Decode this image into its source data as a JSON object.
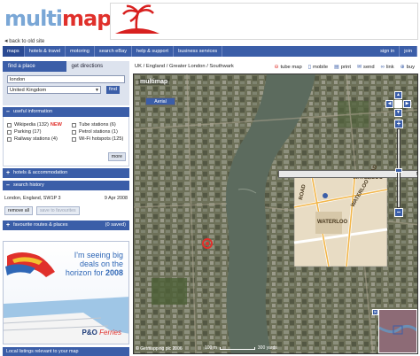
{
  "header": {
    "logo_part1": "multi",
    "logo_part2": "map",
    "back_link": "back to old site"
  },
  "nav": {
    "items": [
      "maps",
      "hotels & travel",
      "motoring",
      "search eBay",
      "help & support",
      "business services"
    ],
    "right_items": [
      "sign in",
      "join"
    ]
  },
  "panel": {
    "tab_find": "find a place",
    "tab_directions": "get directions",
    "search_value": "london",
    "country_value": "United Kingdom",
    "find_button": "find",
    "useful_header": "useful information",
    "useful_items": [
      {
        "label": "Wikipedia (132)",
        "badge": "NEW"
      },
      {
        "label": "Tube stations (6)",
        "badge": ""
      },
      {
        "label": "Parking (17)",
        "badge": ""
      },
      {
        "label": "Petrol stations (1)",
        "badge": ""
      },
      {
        "label": "Railway stations (4)",
        "badge": ""
      },
      {
        "label": "Wi-Fi hotspots (125)",
        "badge": ""
      }
    ],
    "more_button": "more",
    "hotels_header": "hotels & accommodation",
    "history_header": "search history",
    "history_place": "London, England, SW1P 3",
    "history_date": "9 Apr 2008",
    "remove_all": "remove all",
    "save_favourites": "save to favourites",
    "favourites_header": "favourite routes & places",
    "favourites_count": "(0 saved)",
    "bottom_link": "Local listings relevant to your map"
  },
  "ad_left": {
    "line1": "I'm seeing big",
    "line2": "deals on the",
    "line3": "horizon for",
    "year": "2008",
    "brand": "P&O",
    "brand2": "Ferries"
  },
  "map": {
    "breadcrumb": "UK / England / Greater London / Southwark",
    "tools": [
      {
        "icon": "tube-icon",
        "label": "tube map"
      },
      {
        "icon": "mobile-icon",
        "label": "mobile"
      },
      {
        "icon": "print-icon",
        "label": "print"
      },
      {
        "icon": "send-icon",
        "label": "send"
      },
      {
        "icon": "link-icon",
        "label": "link"
      },
      {
        "icon": "buy-icon",
        "label": "buy"
      }
    ],
    "map_logo": "multimap",
    "type_map": "Map",
    "type_aerial": "Aerial",
    "copyright": "© Getmapping plc 2006",
    "scale_left": "100 m",
    "scale_right": "300 yards",
    "street_labels": [
      "WATERLOO",
      "WATERLOO",
      "WATERLOO ROAD",
      "ROAD"
    ],
    "colors": {
      "nav": "#3b5ea8",
      "accent_red": "#e0302b",
      "logo_blue": "#7aa7d6"
    }
  }
}
